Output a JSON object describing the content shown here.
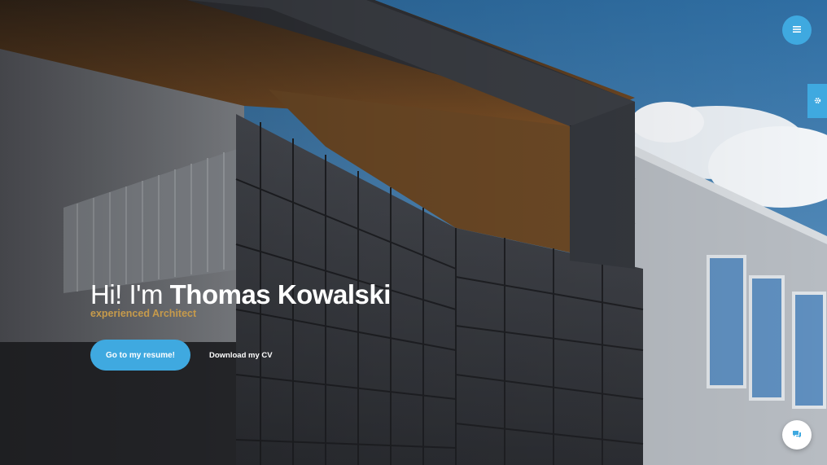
{
  "hero": {
    "greeting": "Hi! I'm",
    "name": "Thomas Kowalski",
    "subtitle": "experienced Architect",
    "primary_button": "Go to my resume!",
    "secondary_button": "Download my CV"
  },
  "icons": {
    "menu": "menu-icon",
    "settings": "gear-icon",
    "chat": "chat-icon"
  },
  "colors": {
    "accent": "#3fa9e0",
    "subtitle": "#c69a4b",
    "sky": "#4a86b8"
  }
}
